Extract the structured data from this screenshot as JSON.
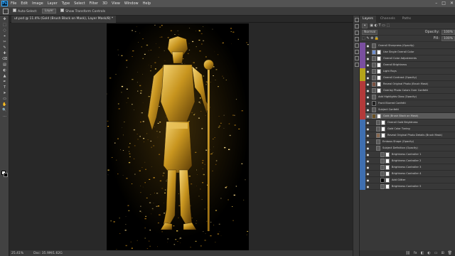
{
  "app": {
    "logo": "Ps"
  },
  "menu": [
    "File",
    "Edit",
    "Image",
    "Layer",
    "Type",
    "Select",
    "Filter",
    "3D",
    "View",
    "Window",
    "Help"
  ],
  "window_controls": [
    "–",
    "□",
    "✕"
  ],
  "options": {
    "auto_select_label": "Auto-Select:",
    "auto_select_value": "Layer",
    "transform_label": "Show Transform Controls"
  },
  "tools": [
    "✥",
    "⬚",
    "◌",
    "⌖",
    "✂",
    "✎",
    "✚",
    "⌫",
    "▤",
    "◐",
    "▲",
    "✒",
    "T",
    "➤",
    "▭",
    "✋",
    "🔍",
    "…"
  ],
  "document": {
    "tab_title": "ut.psd @ 11.4% (Gold (Brush Black on Mask), Layer Mask/8) *"
  },
  "status": {
    "zoom": "25.41%",
    "doc_size": "Doc: 35.9M/1.62G"
  },
  "panel": {
    "tabs": [
      "Layers",
      "Channels",
      "Paths"
    ],
    "blend_mode": "Normal",
    "opacity_label": "Opacity:",
    "opacity_value": "100%",
    "fill_label": "Fill:",
    "fill_value": "100%"
  },
  "layers": [
    {
      "name": "Overall Sharpness (Opacity)",
      "color": "#7a4fa0",
      "thumb": "#5a5a5a",
      "mask": false,
      "indent": 0
    },
    {
      "name": "Use Single Overall Color",
      "color": "#7a4fa0",
      "thumb": "#6f8fcf",
      "mask": true,
      "indent": 0
    },
    {
      "name": "Overall Color Adjustments",
      "color": "#7a4fa0",
      "thumb": "#5a5a5a",
      "mask": true,
      "indent": 0
    },
    {
      "name": "Overall Brightness",
      "color": "#7a4fa0",
      "thumb": "#5a5a5a",
      "mask": true,
      "indent": 0
    },
    {
      "name": "Light Rays",
      "color": "#b5a41a",
      "thumb": "#5a5a5a",
      "mask": true,
      "indent": 0
    },
    {
      "name": "Overall Contrast (Opacity)",
      "color": "#b5a41a",
      "thumb": "#5a5a5a",
      "mask": true,
      "indent": 0
    },
    {
      "name": "Reveal Original Photo (Brush Mask)",
      "color": "#b33a3a",
      "thumb": "#7a5040",
      "mask": true,
      "indent": 0
    },
    {
      "name": "Overlay Photo Colors Over Confetti",
      "color": "#b33a3a",
      "thumb": "#5a5a5a",
      "mask": true,
      "indent": 0
    },
    {
      "name": "Add Highlights Glow (Opacity)",
      "color": "#b33a3a",
      "thumb": "#5a5a5a",
      "mask": false,
      "indent": 0
    },
    {
      "name": "Front Blurred Confetti",
      "color": "#b33a3a",
      "thumb": "#222222",
      "mask": false,
      "indent": 0
    },
    {
      "name": "Subject Confetti",
      "color": "#b33a3a",
      "thumb": "#5a5a5a",
      "mask": false,
      "indent": 0
    },
    {
      "name": "Gold (Brush Black on Mask)",
      "color": "#b33a3a",
      "thumb": "#6a5020",
      "mask": true,
      "indent": 0,
      "selected": true
    },
    {
      "name": "Overall Gold Brightness",
      "color": "#3f6fb0",
      "thumb": "#5a5a5a",
      "mask": true,
      "indent": 1
    },
    {
      "name": "Gold Color Tuning",
      "color": "#3f6fb0",
      "thumb": "#5a5a5a",
      "mask": true,
      "indent": 1
    },
    {
      "name": "Reveal Original Photo Details (Brush Mask)",
      "color": "#3f6fb0",
      "thumb": "#8a6a50",
      "mask": true,
      "indent": 1
    },
    {
      "name": "Emboss Shape (Opacity)",
      "color": "#3f6fb0",
      "thumb": "#5a5a5a",
      "mask": false,
      "indent": 1
    },
    {
      "name": "Subject Definition (Opacity)",
      "color": "#3f6fb0",
      "thumb": "#5a5a5a",
      "mask": false,
      "indent": 1
    },
    {
      "name": "Brightness Controller 1",
      "color": "#3f6fb0",
      "thumb": "#5a5a5a",
      "mask": true,
      "indent": 2
    },
    {
      "name": "Brightness Controller 2",
      "color": "#3f6fb0",
      "thumb": "#5a5a5a",
      "mask": true,
      "indent": 2
    },
    {
      "name": "Brightness Controller 3",
      "color": "#3f6fb0",
      "thumb": "#5a5a5a",
      "mask": true,
      "indent": 2
    },
    {
      "name": "Brightness Controller 4",
      "color": "#3f6fb0",
      "thumb": "#5a5a5a",
      "mask": true,
      "indent": 2
    },
    {
      "name": "Add Glitter",
      "color": "#3f6fb0",
      "thumb": "#000000",
      "mask": true,
      "indent": 2
    },
    {
      "name": "Brightness Controller 5",
      "color": "#3f6fb0",
      "thumb": "#5a5a5a",
      "mask": true,
      "indent": 2
    }
  ],
  "panel_footer": [
    "⛓",
    "fx",
    "◧",
    "◐",
    "▭",
    "⊞",
    "🗑"
  ]
}
